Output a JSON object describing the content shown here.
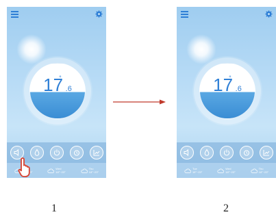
{
  "screens": [
    {
      "temperature_int": "17",
      "temperature_dec": ".6",
      "degree_symbol": "°",
      "forecast": [
        {
          "day": "Tue",
          "range": "19°~23°"
        },
        {
          "day": "Wed",
          "range": "18°~23°"
        },
        {
          "day": "Thu",
          "range": "18°~23°"
        }
      ]
    },
    {
      "temperature_int": "17",
      "temperature_dec": ".6",
      "degree_symbol": "°",
      "forecast": [
        {
          "day": "Tue",
          "range": "19°~23°"
        },
        {
          "day": "Wed",
          "range": "18°~23°"
        },
        {
          "day": "Thu",
          "range": "18°~23°"
        }
      ]
    }
  ],
  "step_labels": [
    "1",
    "2"
  ],
  "controls": [
    "speaker-icon",
    "water-drop-icon",
    "power-icon",
    "alarm-clock-icon",
    "chart-icon"
  ],
  "colors": {
    "accent": "#2e7fd6",
    "arrow": "#c0392b",
    "hand": "#d9412f"
  }
}
